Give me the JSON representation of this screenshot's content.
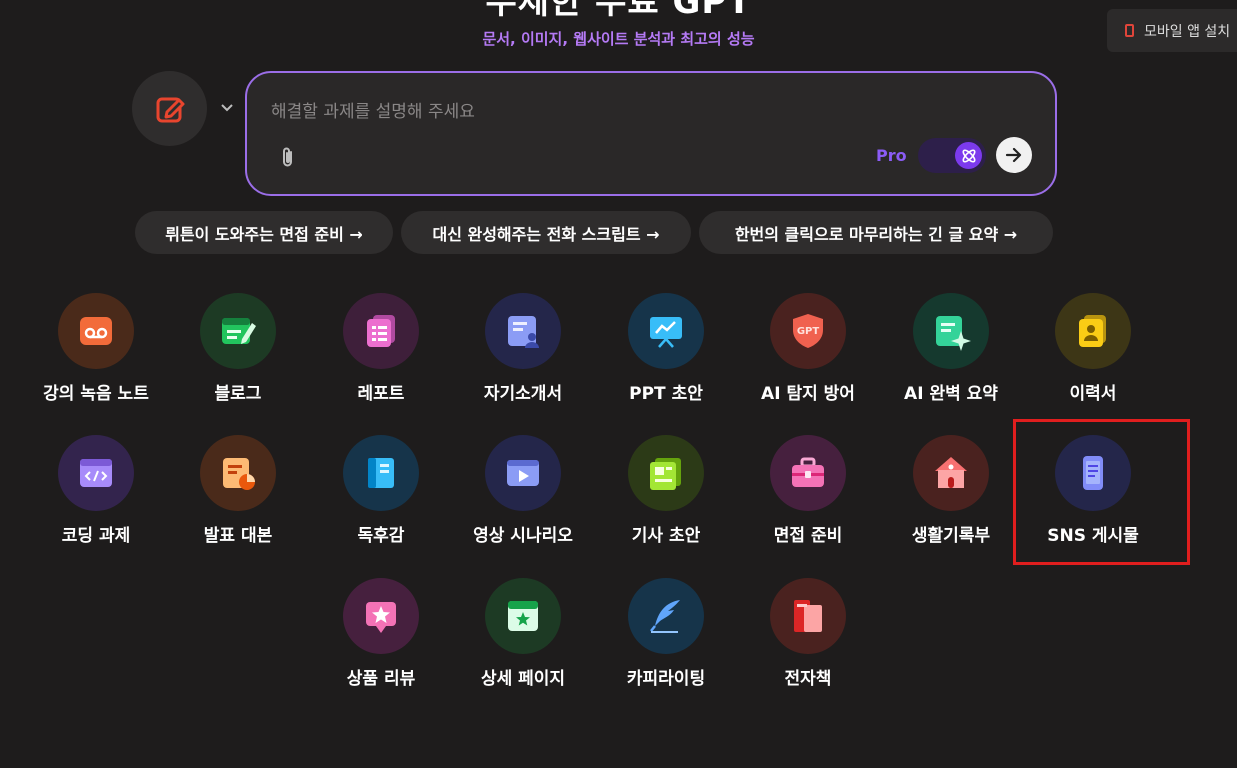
{
  "header": {
    "title": "무제한 무료 GPT",
    "subtitle": "문서, 이미지, 웹사이트 분석과 최고의 성능",
    "mobile_button_label": "모바일 앱 설치"
  },
  "composer": {
    "placeholder": "해결할 과제를 설명해 주세요",
    "pro_label": "Pro",
    "pro_enabled": true,
    "mode_icon": "edit-icon",
    "colors": {
      "accent": "#9b6ee8",
      "pro": "#8b5cf6",
      "mode_icon": "#e8452e"
    }
  },
  "suggestions": [
    {
      "label": "뤼튼이 도와주는 면접 준비 →"
    },
    {
      "label": "대신 완성해주는 전화 스크립트 →"
    },
    {
      "label": "한번의 클릭으로 마무리하는 긴 글 요약 →"
    }
  ],
  "tools": [
    {
      "label": "강의 녹음 노트",
      "icon": "voicemail-icon",
      "color": "#f26b3a"
    },
    {
      "label": "블로그",
      "icon": "blog-edit-icon",
      "color": "#22c55e"
    },
    {
      "label": "레포트",
      "icon": "report-icon",
      "color": "#ec6fcf"
    },
    {
      "label": "자기소개서",
      "icon": "profile-doc-icon",
      "color": "#8b9cf5"
    },
    {
      "label": "PPT 초안",
      "icon": "presentation-icon",
      "color": "#38bdf8"
    },
    {
      "label": "AI 탐지 방어",
      "icon": "gpt-shield-icon",
      "color": "#f0614f"
    },
    {
      "label": "AI 완벽 요약",
      "icon": "sparkle-doc-icon",
      "color": "#34d399"
    },
    {
      "label": "이력서",
      "icon": "resume-icon",
      "color": "#facc15"
    },
    {
      "label": "코딩 과제",
      "icon": "code-window-icon",
      "color": "#a78bfa"
    },
    {
      "label": "발표 대본",
      "icon": "chart-doc-icon",
      "color": "#fb923c"
    },
    {
      "label": "독후감",
      "icon": "book-icon",
      "color": "#38bdf8"
    },
    {
      "label": "영상 시나리오",
      "icon": "video-icon",
      "color": "#8b9cf5"
    },
    {
      "label": "기사 초안",
      "icon": "newspaper-icon",
      "color": "#a3e635"
    },
    {
      "label": "면접 준비",
      "icon": "briefcase-icon",
      "color": "#f472b6"
    },
    {
      "label": "생활기록부",
      "icon": "school-icon",
      "color": "#f87171"
    },
    {
      "label": "SNS 게시물",
      "icon": "phone-post-icon",
      "color": "#818cf8"
    },
    {
      "label": "상품 리뷰",
      "icon": "star-review-icon",
      "color": "#f472b6"
    },
    {
      "label": "상세 페이지",
      "icon": "star-page-icon",
      "color": "#4ade80"
    },
    {
      "label": "카피라이팅",
      "icon": "quill-icon",
      "color": "#60a5fa"
    },
    {
      "label": "전자책",
      "icon": "ebook-icon",
      "color": "#f87171"
    }
  ]
}
